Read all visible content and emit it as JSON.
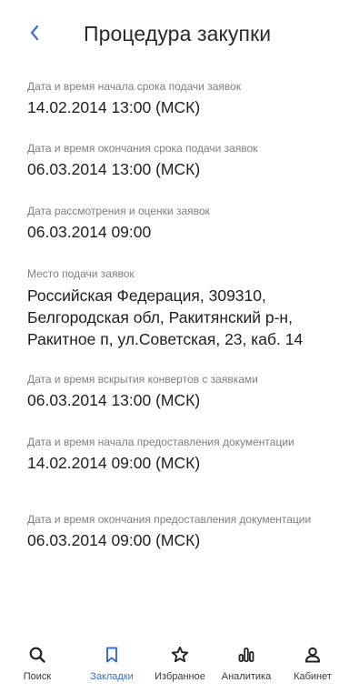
{
  "header": {
    "title": "Процедура закупки",
    "back_icon": "chevron-left-icon"
  },
  "fields": [
    {
      "label": "Дата и время начала срока подачи заявок",
      "value": "14.02.2014 13:00 (МСК)"
    },
    {
      "label": "Дата и время окончания срока подачи заявок",
      "value": "06.03.2014 13:00 (МСК)"
    },
    {
      "label": "Дата рассмотрения и оценки заявок",
      "value": "06.03.2014 09:00"
    },
    {
      "label": "Место подачи заявок",
      "value": "Российская Федерация, 309310, Белгородская обл, Ракитянский р-н, Ракитное п, ул.Советская, 23, каб. 14"
    },
    {
      "label": "Дата и время вскрытия конвертов с заявками",
      "value": "06.03.2014 13:00 (МСК)"
    },
    {
      "label": "Дата и время начала предоставления документации",
      "value": "14.02.2014 09:00 (МСК)"
    },
    {
      "label": "Дата и время окончания предоставления документации",
      "value": "06.03.2014 09:00 (МСК)"
    }
  ],
  "bottom_nav": {
    "items": [
      {
        "label": "Поиск",
        "icon": "search-icon",
        "active": false
      },
      {
        "label": "Закладки",
        "icon": "bookmark-icon",
        "active": true
      },
      {
        "label": "Избранное",
        "icon": "star-icon",
        "active": false
      },
      {
        "label": "Аналитика",
        "icon": "analytics-icon",
        "active": false
      },
      {
        "label": "Кабинет",
        "icon": "user-icon",
        "active": false
      }
    ]
  },
  "colors": {
    "accent": "#3b6fd8",
    "label": "#7f7f7f",
    "text": "#1f1f1f"
  }
}
